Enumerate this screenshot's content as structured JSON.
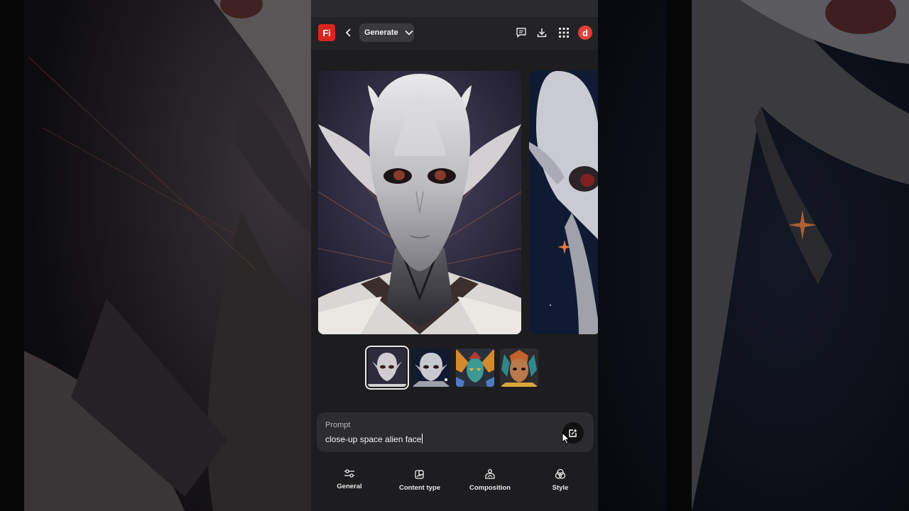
{
  "app": {
    "logo_text": "Fi",
    "mode_label": "Generate",
    "avatar_letter": "d",
    "colors": {
      "accent": "#d7261e",
      "avatar": "#e0413a",
      "panel": "#1d1d1f"
    }
  },
  "topbar": {
    "icons": [
      "feedback-icon",
      "download-icon",
      "apps-grid-icon"
    ]
  },
  "gallery": {
    "thumbnails": [
      {
        "name": "thumb-alien-white",
        "selected": true
      },
      {
        "name": "thumb-alien-space",
        "selected": false
      },
      {
        "name": "thumb-alien-colorful",
        "selected": false
      },
      {
        "name": "thumb-alien-tribal",
        "selected": false
      }
    ]
  },
  "prompt": {
    "label": "Prompt",
    "value": "close-up space alien face"
  },
  "tabs": [
    {
      "label": "General",
      "icon": "sliders-icon"
    },
    {
      "label": "Content type",
      "icon": "content-type-icon"
    },
    {
      "label": "Composition",
      "icon": "composition-icon"
    },
    {
      "label": "Style",
      "icon": "style-icon"
    }
  ]
}
